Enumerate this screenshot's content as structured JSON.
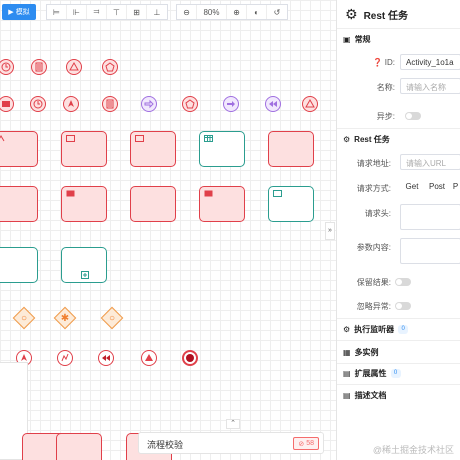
{
  "toolbar": {
    "simulate_label": "模拟",
    "zoom_value": "80%"
  },
  "canvas": {
    "bottom_bar_label": "流程校验",
    "error_count": "58"
  },
  "panel": {
    "title": "Rest 任务",
    "general": {
      "title": "常规",
      "id_label": "ID:",
      "id_value": "Activity_1o1a",
      "name_label": "名称:",
      "name_placeholder": "请输入名称",
      "async_label": "异步:"
    },
    "rest": {
      "title": "Rest 任务",
      "url_label": "请求地址:",
      "url_placeholder": "请输入URL",
      "method_label": "请求方式:",
      "method_get": "Get",
      "method_post": "Post",
      "method_third": "P",
      "headers_label": "请求头:",
      "params_label": "参数内容:",
      "keep_result_label": "保留结果:",
      "ignore_error_label": "忽略异常:"
    },
    "sections": [
      {
        "label": "执行监听器",
        "badge": "0"
      },
      {
        "label": "多实例",
        "badge": ""
      },
      {
        "label": "扩展属性",
        "badge": "0"
      },
      {
        "label": "描述文档",
        "badge": ""
      }
    ]
  },
  "watermark": "@稀土掘金技术社区",
  "colors": {
    "accent": "#2d8cf0",
    "event_red": "#e0404a",
    "task_fill": "#fde0e0",
    "teal": "#2b9d8f",
    "gateway": "#f09b4a"
  }
}
